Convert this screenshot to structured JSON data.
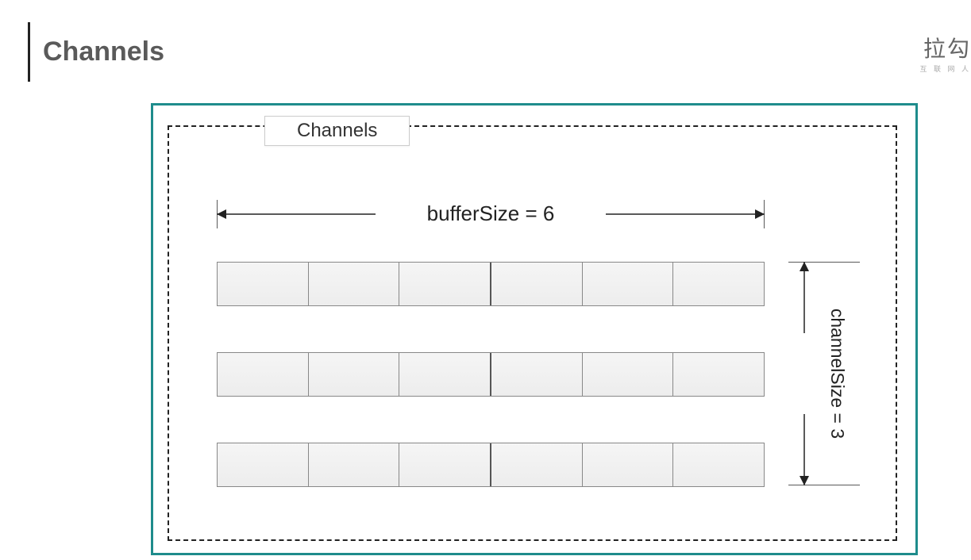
{
  "title": "Channels",
  "logo": {
    "main": "拉勾",
    "sub": "互 联 网 人"
  },
  "diagram": {
    "label": "Channels",
    "hdim_label": "bufferSize = 6",
    "vdim_label": "channelSize\n= 3",
    "bufferSize": 6,
    "channelSize": 3
  }
}
